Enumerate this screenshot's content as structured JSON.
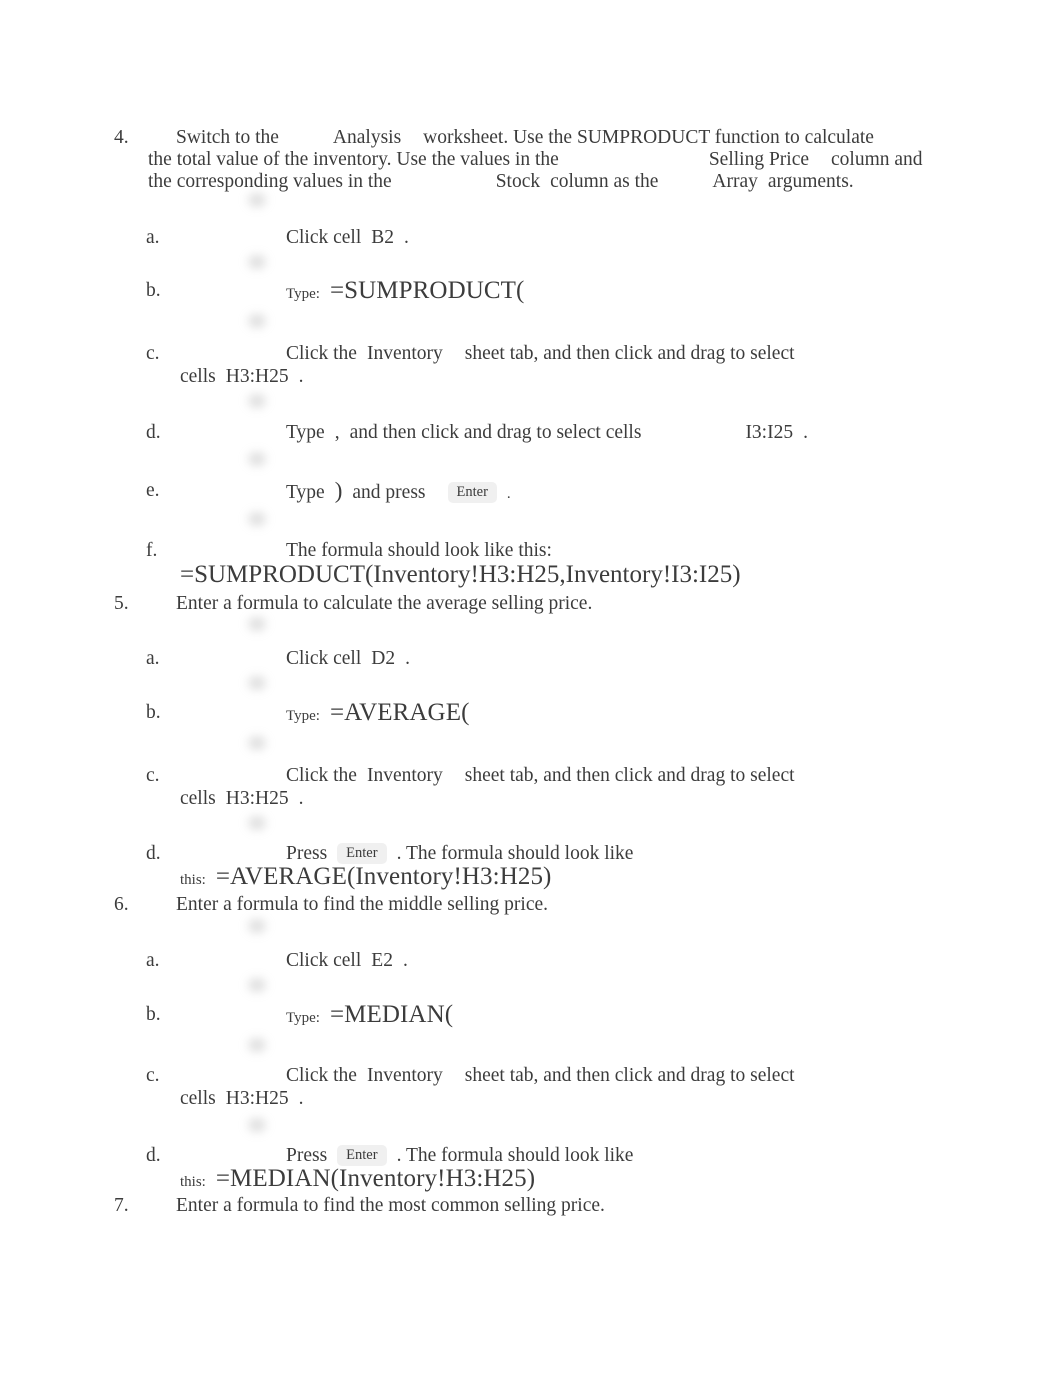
{
  "document": {
    "background_color": "#ffffff",
    "text_color": "#3c3c3c"
  },
  "steps": [
    {
      "number": "4.",
      "text_line1_a": "Switch to the",
      "text_line1_b": "Analysis",
      "text_line1_c": "worksheet. Use the SUMPRODUCT function to calculate",
      "text_line2_a": "the total value of the inventory. Use the values in the",
      "text_line2_b": "Selling Price",
      "text_line2_c": "column and",
      "text_line3_a": "the corresponding values in the",
      "text_line3_b": "Stock",
      "text_line3_c": "column as the",
      "text_line3_d": "Array",
      "text_line3_e": "arguments.",
      "substeps": [
        {
          "marker": "a.",
          "lead": "Click cell",
          "target": "B2",
          "tail": "."
        },
        {
          "marker": "b.",
          "label": "Type:",
          "formula": "=SUMPRODUCT("
        },
        {
          "marker": "c.",
          "lead": "Click the",
          "sheet": "Inventory",
          "mid": "sheet tab, and then click and drag to select",
          "wrap_lead": "cells",
          "range": "H3:H25",
          "wrap_tail": "."
        },
        {
          "marker": "d.",
          "lead": "Type",
          "symbol": ",",
          "mid": "and then click and drag to select cells",
          "range": "I3:I25",
          "tail": "."
        },
        {
          "marker": "e.",
          "lead": "Type",
          "symbol": ")",
          "mid": "and press",
          "key": "Enter",
          "tail": "."
        },
        {
          "marker": "f.",
          "lead": "The formula should look like this:",
          "formula": "=SUMPRODUCT(Inventory!H3:H25,Inventory!I3:I25)"
        }
      ]
    },
    {
      "number": "5.",
      "text": "Enter a formula to calculate the average selling price.",
      "substeps": [
        {
          "marker": "a.",
          "lead": "Click cell",
          "target": "D2",
          "tail": "."
        },
        {
          "marker": "b.",
          "label": "Type:",
          "formula": "=AVERAGE("
        },
        {
          "marker": "c.",
          "lead": "Click the",
          "sheet": "Inventory",
          "mid": "sheet tab, and then click and drag to select",
          "wrap_lead": "cells",
          "range": "H3:H25",
          "wrap_tail": "."
        },
        {
          "marker": "d.",
          "lead": "Press",
          "key": "Enter",
          "mid": ". The formula should look like",
          "wrap_label": "this:",
          "formula": "=AVERAGE(Inventory!H3:H25)"
        }
      ]
    },
    {
      "number": "6.",
      "text": "Enter a formula to find the middle selling price.",
      "substeps": [
        {
          "marker": "a.",
          "lead": "Click cell",
          "target": "E2",
          "tail": "."
        },
        {
          "marker": "b.",
          "label": "Type:",
          "formula": "=MEDIAN("
        },
        {
          "marker": "c.",
          "lead": "Click the",
          "sheet": "Inventory",
          "mid": "sheet tab, and then click and drag to select",
          "wrap_lead": "cells",
          "range": "H3:H25",
          "wrap_tail": "."
        },
        {
          "marker": "d.",
          "lead": "Press",
          "key": "Enter",
          "mid": ". The formula should look like",
          "wrap_label": "this:",
          "formula": "=MEDIAN(Inventory!H3:H25)"
        }
      ]
    },
    {
      "number": "7.",
      "text": "Enter a formula to find the most common selling price."
    }
  ]
}
